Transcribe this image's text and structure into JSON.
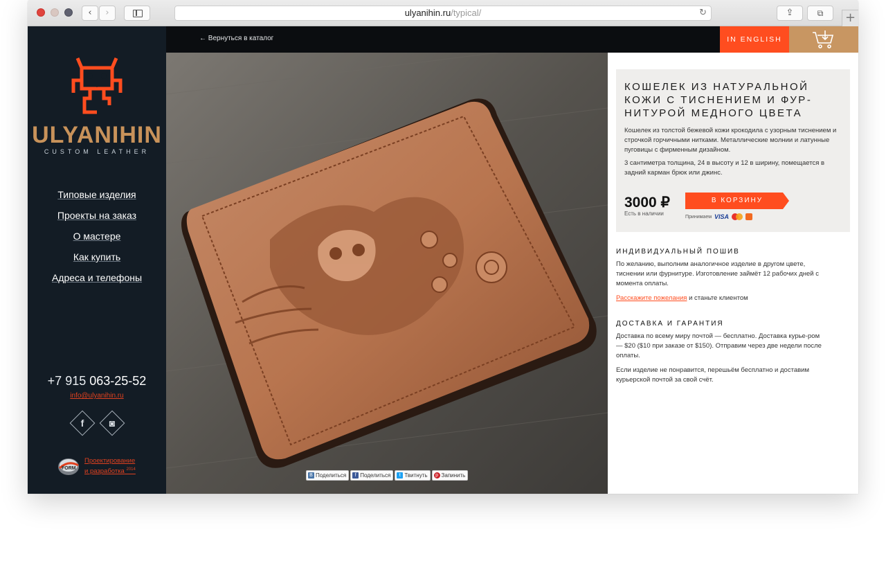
{
  "browser": {
    "url_host": "ulyanihin.ru",
    "url_path": "/typical/",
    "back_glyph": "‹",
    "forward_glyph": "›",
    "reload_glyph": "↻",
    "share_glyph": "⇪",
    "tabs_glyph": "⧉",
    "newtab_glyph": "+"
  },
  "sidebar": {
    "brand": "ULYANIHIN",
    "tagline": "CUSTOM LEATHER",
    "menu": [
      {
        "label": "Типовые изделия"
      },
      {
        "label": "Проекты на заказ"
      },
      {
        "label": "О мастере"
      },
      {
        "label": "Как купить"
      },
      {
        "label": "Адреса и телефоны"
      }
    ],
    "phone_prefix": "+7 915",
    "phone_number": " 063-25-52",
    "email": "info@ulyanihin.ru",
    "facebook_glyph": "f",
    "instagram_glyph": "◙",
    "credit_line1": "Проектирование",
    "credit_line2": "и разработка",
    "credit_year": "2014",
    "form_logo_text": "FORM"
  },
  "topbar": {
    "back_link": "← Вернуться в каталог",
    "language": "IN ENGLISH"
  },
  "product": {
    "title": "Кошелек из натуральной кожи с тиснением и фур-нитурой медного цвета",
    "description": "Кошелек из толстой бежевой кожи крокодила с узорным тиснением и строчкой горчичными нитками. Металлические молнии и латунные пуговицы с фирменным дизайном.",
    "dimensions": "3 сантиметра толщина, 24 в высоту и 12 в ширину, помещается в задний карман брюк или джинс.",
    "price": "3000 ₽",
    "stock": "Есть в наличии",
    "buy_label": "В КОРЗИНУ",
    "accept_label": "Принимаем",
    "visa": "VISA"
  },
  "share": [
    {
      "label": "Поделиться",
      "icon": "B",
      "color": "#4a76a8"
    },
    {
      "label": "Поделиться",
      "icon": "f",
      "color": "#3b5998"
    },
    {
      "label": "Твитнуть",
      "icon": "t",
      "color": "#1da1f2"
    },
    {
      "label": "Запинить",
      "icon": "p",
      "color": "#cb2027"
    }
  ],
  "custom": {
    "heading": "Индивидуальный пошив",
    "text": "По желанию, выполним аналогичное изделие в другом цвете, тиснении или фурнитуре. Изготовление займёт 12 рабочих дней с момента оплаты.",
    "link": "Расскажите пожелания",
    "link_suffix": " и станьте клиентом"
  },
  "delivery": {
    "heading": "Доставка и гарантия",
    "text1": "Доставка по всему миру почтой — бесплатно. Доставка курье-ром — $20 ($10 при заказе от $150). Отправим через две недели после оплаты.",
    "text2": "Если изделие не понравится, перешьём бесплатно и доставим курьерской почтой за свой счёт."
  },
  "colors": {
    "accent": "#ff4d1f",
    "sidebar_bg": "#131c25",
    "cart_bg": "#c89662",
    "brand_gold": "#c8925a"
  }
}
